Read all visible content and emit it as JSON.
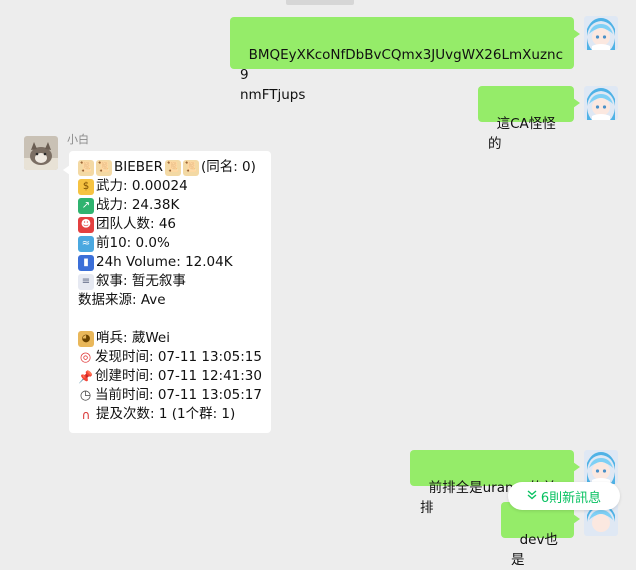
{
  "messages": [
    {
      "side": "out",
      "text": "BMQEyXKcoNfDbBvCQmx3JUvgWX26LmXuznc9\nnmFTjups"
    },
    {
      "side": "out",
      "text": "這CA怪怪的"
    },
    {
      "side": "in",
      "sender": "小白",
      "lines": [
        {
          "icons": [
            "scroll-icon",
            "scroll-icon"
          ],
          "text": "BIEBER"
        },
        {
          "icons": [
            "scroll-icon",
            "scroll-icon"
          ],
          "text": "(同名: 0)"
        },
        {
          "icons": [
            "money-bag-icon"
          ],
          "text": "武力: 0.00024"
        },
        {
          "icons": [
            "chart-up-icon"
          ],
          "text": "战力: 24.38K"
        },
        {
          "icons": [
            "santa-icon"
          ],
          "text": "团队人数: 46"
        },
        {
          "icons": [
            "whale-icon"
          ],
          "text": "前10: 0.0%"
        },
        {
          "icons": [
            "bar-chart-icon"
          ],
          "text": "24h Volume: 12.04K"
        },
        {
          "icons": [
            "page-icon"
          ],
          "text": "叙事: 暂无叙事"
        },
        {
          "icons": [],
          "text": "数据来源: Ave"
        },
        {
          "icons": [],
          "text": ""
        },
        {
          "icons": [
            "doge-icon"
          ],
          "text": "哨兵: 葳Wei"
        },
        {
          "icons": [
            "target-icon"
          ],
          "text": "发现时间: 07-11 13:05:15"
        },
        {
          "icons": [
            "pin-icon"
          ],
          "text": "创建时间: 07-11 12:41:30"
        },
        {
          "icons": [
            "clock-icon"
          ],
          "text": "当前时间: 07-11 13:05:17"
        },
        {
          "icons": [
            "magnet-icon"
          ],
          "text": "提及次数: 1 (1个群: 1)"
        }
      ]
    },
    {
      "side": "out",
      "text": "前排全是uranus的前排"
    },
    {
      "side": "out",
      "text": "dev也是"
    }
  ],
  "new_messages_pill": {
    "label": "6則新訊息",
    "icon": "double-chevron-down-icon"
  },
  "colors": {
    "outgoing_bubble": "#95ec69",
    "incoming_bubble": "#ffffff",
    "background": "#ededed",
    "pill_text": "#07c160"
  }
}
